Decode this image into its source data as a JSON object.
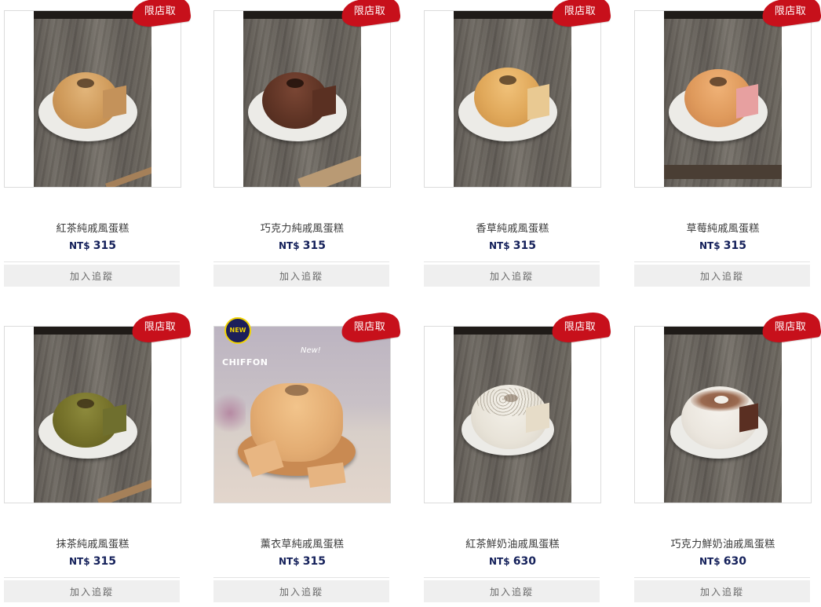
{
  "ribbon_label": "限店取",
  "currency": "NT$",
  "button_label": "加入追蹤",
  "new_badge": "NEW",
  "brand": "CHIFFON",
  "script_label": "New!",
  "products": [
    {
      "name": "紅茶純戚風蛋糕",
      "price": "315"
    },
    {
      "name": "巧克力純戚風蛋糕",
      "price": "315"
    },
    {
      "name": "香草純戚風蛋糕",
      "price": "315"
    },
    {
      "name": "草莓純戚風蛋糕",
      "price": "315"
    },
    {
      "name": "抹茶純戚風蛋糕",
      "price": "315"
    },
    {
      "name": "薰衣草純戚風蛋糕",
      "price": "315"
    },
    {
      "name": "紅茶鮮奶油戚風蛋糕",
      "price": "630"
    },
    {
      "name": "巧克力鮮奶油戚風蛋糕",
      "price": "630"
    }
  ],
  "colors": {
    "ribbon": "#c7101b",
    "price": "#14205a",
    "button_bg": "#efefef"
  }
}
